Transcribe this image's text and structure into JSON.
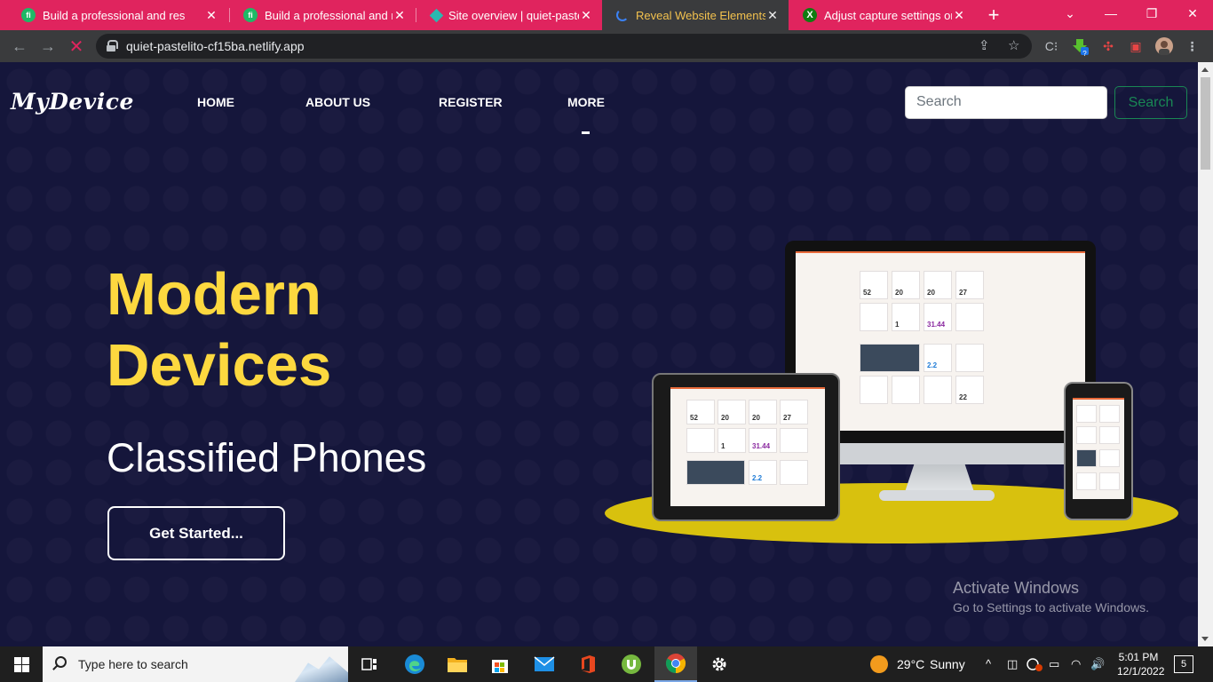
{
  "browser": {
    "tabs": [
      {
        "title": "Build a professional and res",
        "favicon": "fiverr-icon"
      },
      {
        "title": "Build a professional and res",
        "favicon": "fiverr-icon"
      },
      {
        "title": "Site overview | quiet-pasteli",
        "favicon": "netlify-icon"
      },
      {
        "title": "Reveal Website Elements O",
        "favicon": "loading-spinner-icon",
        "active": true
      },
      {
        "title": "Adjust capture settings on",
        "favicon": "xbox-icon"
      }
    ],
    "favicon_text": {
      "fiverr": "fi",
      "xbox": "X"
    },
    "new_tab": "+",
    "close_glyph": "✕",
    "window_controls": {
      "tab_search": "⌄",
      "minimize": "—",
      "restore": "❐",
      "close": "✕"
    },
    "nav": {
      "back": "←",
      "forward": "→",
      "stop": "✕"
    },
    "url": "quiet-pastelito-cf15ba.netlify.app",
    "omnibox_icons": {
      "share": "⇪",
      "bookmark": "☆"
    },
    "extension_icons": {
      "c": "C⁝",
      "puzzle": "✣",
      "sidebar": "▣",
      "badge": "?"
    }
  },
  "site": {
    "logo": "MyDevice",
    "nav": [
      "HOME",
      "ABOUT US",
      "REGISTER",
      "MORE"
    ],
    "search_placeholder": "Search",
    "search_button": "Search",
    "hero_title_line1": "Modern",
    "hero_title_line2": "Devices",
    "hero_subtitle": "Classified Phones",
    "cta": "Get Started...",
    "screen_tiles": [
      "52",
      "20",
      "20",
      "27",
      "1",
      "31.44",
      "2.2",
      "22"
    ]
  },
  "watermark": {
    "line1": "Activate Windows",
    "line2": "Go to Settings to activate Windows."
  },
  "taskbar": {
    "search_placeholder": "Type here to search",
    "weather_temp": "29°C",
    "weather_text": "Sunny",
    "time": "5:01 PM",
    "date": "12/1/2022",
    "notifications": "5",
    "tray_icons": {
      "chevron": "^",
      "meet": "◫",
      "volume": "🔊",
      "wifi": "◠",
      "battery": "▭"
    }
  },
  "colors": {
    "tab_strip": "#e0245e",
    "site_background": "#15163b",
    "hero_yellow": "#fdd83f",
    "stage_yellow": "#d8c10e",
    "search_button_green": "#198754"
  }
}
